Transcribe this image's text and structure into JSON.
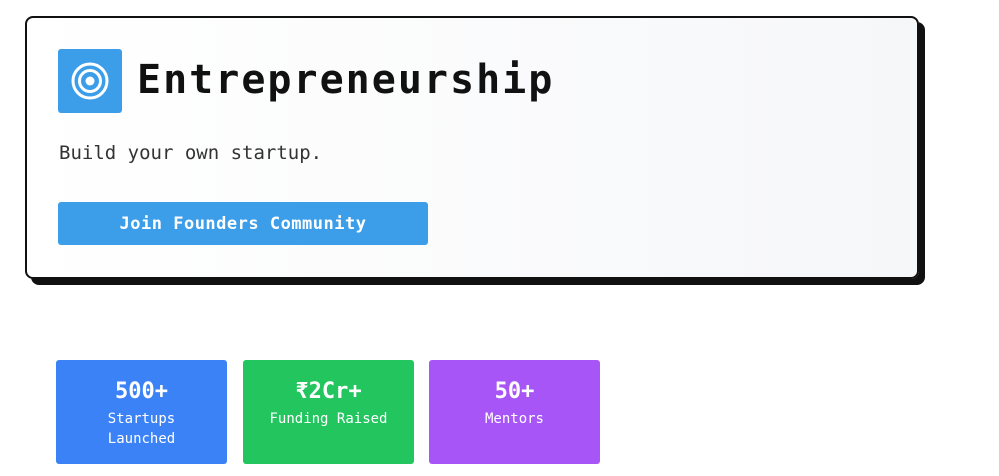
{
  "hero": {
    "icon": "target-icon",
    "title": "Entrepreneurship",
    "subtitle": "Build your own startup.",
    "cta_label": "Join Founders Community",
    "accent_color": "#3c9de8"
  },
  "stats": [
    {
      "value": "500+",
      "label": "Startups Launched",
      "color": "#3b82f6"
    },
    {
      "value": "₹2Cr+",
      "label": "Funding Raised",
      "color": "#22c55e"
    },
    {
      "value": "50+",
      "label": "Mentors",
      "color": "#a855f7"
    }
  ]
}
